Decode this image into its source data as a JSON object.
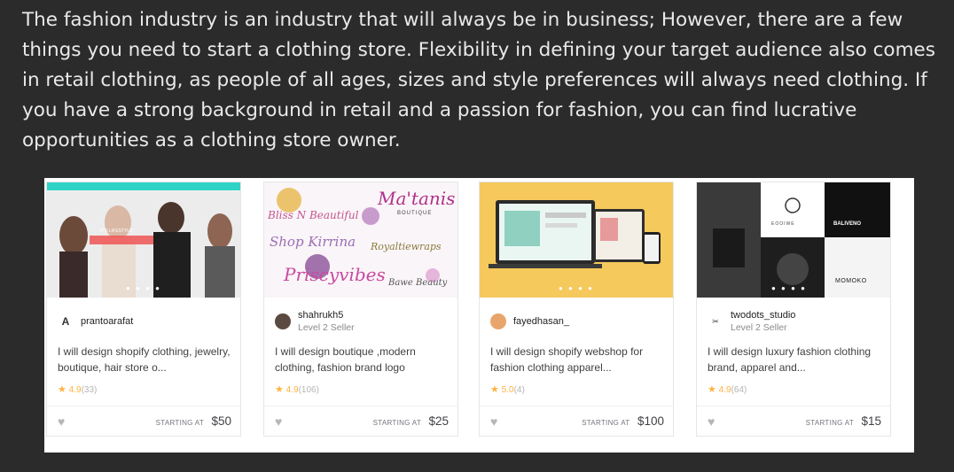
{
  "paragraph": "The fashion industry is an industry that will always be in business; However, there are a few things you need to start a clothing store. Flexibility in defining your target audience also comes in retail clothing, as people of all ages, sizes and style preferences will always need clothing. If you have a strong background in retail and a passion for fashion, you can find lucrative opportunities as a clothing store owner.",
  "gigs": [
    {
      "seller": "prantoarafat",
      "level": "",
      "title": "I will design shopify clothing, jewelry, boutique, hair store o...",
      "rating": "4.9",
      "reviews": "(33)",
      "starting_label": "STARTING AT",
      "price": "$50",
      "thumb_text": [
        "IT'S LIFESTYLE"
      ]
    },
    {
      "seller": "shahrukh5",
      "level": "Level 2 Seller",
      "title": "I will design boutique ,modern clothing, fashion brand logo",
      "rating": "4.9",
      "reviews": "(106)",
      "starting_label": "STARTING AT",
      "price": "$25",
      "thumb_text": [
        "Bliss N Beautiful",
        "Ma'tanis",
        "BOUTIQUE",
        "Shop Kirrina",
        "Royaltiewraps",
        "Priscyvibes",
        "Bawe Beauty"
      ]
    },
    {
      "seller": "fayedhasan_",
      "level": "",
      "title": "I will design shopify webshop for fashion clothing apparel...",
      "rating": "5.0",
      "reviews": "(4)",
      "starting_label": "STARTING AT",
      "price": "$100",
      "thumb_text": []
    },
    {
      "seller": "twodots_studio",
      "level": "Level 2 Seller",
      "title": "I will design luxury fashion clothing brand, apparel and...",
      "rating": "4.9",
      "reviews": "(64)",
      "starting_label": "STARTING AT",
      "price": "$15",
      "thumb_text": [
        "BALIVENO",
        "MOMOKO",
        "EOOIWE"
      ]
    }
  ],
  "colors": {
    "background": "#2b2b2b",
    "text": "#e9e9e9",
    "star": "#ffb33e",
    "panel": "#ffffff"
  },
  "icons": {
    "star": "star-icon",
    "heart": "heart-icon"
  }
}
